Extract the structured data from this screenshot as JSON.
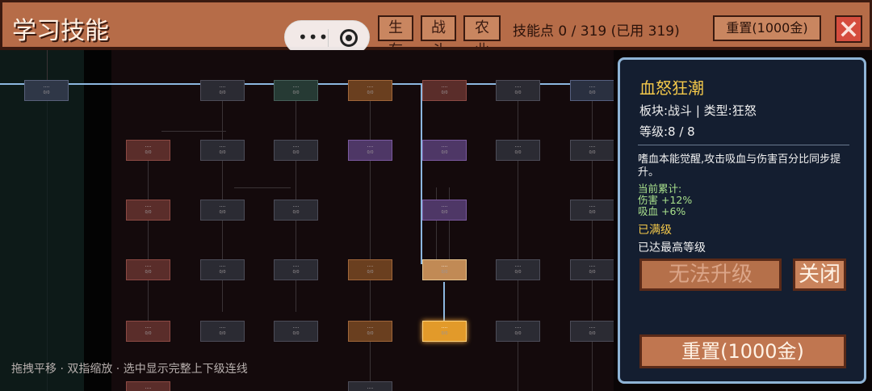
{
  "header": {
    "title": "学习技能",
    "tabs": [
      {
        "label": "生存"
      },
      {
        "label": "战斗"
      },
      {
        "label": "农业"
      }
    ],
    "skill_points": "技能点 0 / 319 (已用 319)",
    "reset_label": "重置(1000金)"
  },
  "hint": "拖拽平移 · 双指缩放 · 选中显示完整上下级连线",
  "panel": {
    "title": "血怒狂潮",
    "meta": "板块:战斗   |   类型:狂怒",
    "level": "等级:8 / 8",
    "description": "嗜血本能觉醒,攻击吸血与伤害百分比同步提升。",
    "accum_title": "当前累计:",
    "accum_damage": "伤害 +12%",
    "accum_lifesteal": "吸血 +6%",
    "maxed": "已满级",
    "maxed_desc": "已达最高等级",
    "cannot_upgrade_label": "无法升级",
    "close_label": "关闭",
    "reset_label": "重置(1000金)"
  },
  "colors": {
    "header_bg": "#b66c48",
    "panel_bg": "#141e30",
    "panel_border": "#8fb4d6",
    "title_gold": "#f3c84a",
    "highlight_line": "#8cb7e0",
    "selected_node": "#e29a2a"
  }
}
